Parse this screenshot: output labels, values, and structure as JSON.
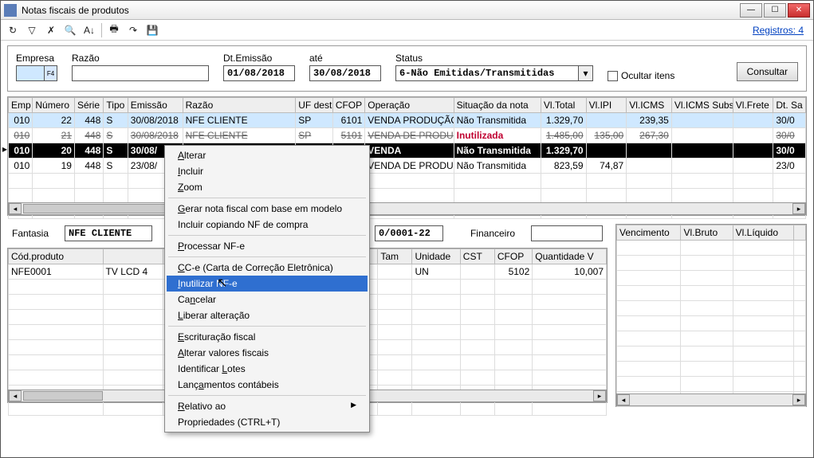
{
  "window": {
    "title": "Notas fiscais de produtos"
  },
  "reg_link": "Registros: 4",
  "filter": {
    "empresa_label": "Empresa",
    "empresa_value": "",
    "razao_label": "Razão",
    "razao_value": "",
    "dtemissao_label": "Dt.Emissão",
    "dtemissao_value": "01/08/2018",
    "ate_label": "até",
    "ate_value": "30/08/2018",
    "status_label": "Status",
    "status_value": "6-Não Emitidas/Transmitidas",
    "ocultar_label": "Ocultar itens",
    "consultar_label": "Consultar"
  },
  "grid1": {
    "columns": [
      "Emp",
      "Número",
      "Série",
      "Tipo",
      "Emissão",
      "Razão",
      "UF dest.",
      "CFOP",
      "Operação",
      "Situação da nota",
      "Vl.Total",
      "Vl.IPI",
      "Vl.ICMS",
      "Vl.ICMS Subs",
      "Vl.Frete",
      "Dt. Sa"
    ],
    "widths": [
      30,
      52,
      36,
      30,
      68,
      140,
      46,
      40,
      110,
      108,
      56,
      50,
      56,
      76,
      50,
      40
    ],
    "rows": [
      {
        "cells": [
          "010",
          "22",
          "448",
          "S",
          "30/08/2018",
          "NFE CLIENTE",
          "SP",
          "6101",
          "VENDA PRODUÇÃO",
          "Não Transmitida",
          "1.329,70",
          "",
          "239,35",
          "",
          "",
          "30/0"
        ],
        "class": "hl"
      },
      {
        "cells": [
          "010",
          "21",
          "448",
          "S",
          "30/08/2018",
          "NFE CLIENTE",
          "SP",
          "5101",
          "VENDA DE PRODU",
          "Inutilizada",
          "1.485,00",
          "135,00",
          "267,30",
          "",
          "",
          "30/0"
        ],
        "class": "canc"
      },
      {
        "cells": [
          "010",
          "20",
          "448",
          "S",
          "30/08/",
          "",
          "",
          "",
          "VENDA",
          "Não Transmitida",
          "1.329,70",
          "",
          "",
          "",
          "",
          "30/0"
        ],
        "class": "sel"
      },
      {
        "cells": [
          "010",
          "19",
          "448",
          "S",
          "23/08/",
          "",
          "",
          "",
          "VENDA DE PRODU",
          "Não Transmitida",
          "823,59",
          "74,87",
          "",
          "",
          "",
          "23/0"
        ],
        "class": ""
      }
    ]
  },
  "details": {
    "fantasia_label": "Fantasia",
    "fantasia_value": "NFE CLIENTE",
    "cnpj_value": "0/0001-22",
    "financeiro_label": "Financeiro",
    "financeiro_value": ""
  },
  "grid2": {
    "columns": [
      "Cód.produto",
      "",
      "",
      "Tam",
      "Unidade",
      "CST",
      "CFOP",
      "Quantidade V"
    ],
    "widths": [
      110,
      70,
      250,
      40,
      56,
      40,
      44,
      86
    ],
    "rows": [
      {
        "cells": [
          "NFE0001",
          "TV LCD 4",
          "",
          "",
          "UN",
          "",
          "5102",
          "10,007"
        ]
      }
    ]
  },
  "grid3": {
    "columns": [
      "Vencimento",
      "Vl.Bruto",
      "Vl.Líquido",
      ""
    ],
    "widths": [
      74,
      60,
      70,
      14
    ]
  },
  "context_menu": {
    "items": [
      {
        "label": "Alterar",
        "u": 0
      },
      {
        "label": "Incluir",
        "u": 0
      },
      {
        "label": "Zoom",
        "u": 0
      },
      {
        "sep": true
      },
      {
        "label": "Gerar nota fiscal com base em modelo",
        "u": 0
      },
      {
        "label": "Incluir copiando NF de compra"
      },
      {
        "sep": true
      },
      {
        "label": "Processar NF-e",
        "u": 0
      },
      {
        "sep": true
      },
      {
        "label": "CC-e (Carta de Correção Eletrônica)",
        "u": 0
      },
      {
        "label": "Inutilizar NF-e",
        "u": 0,
        "hl": true
      },
      {
        "label": "Cancelar",
        "u": 2
      },
      {
        "label": "Liberar alteração",
        "u": 0
      },
      {
        "sep": true
      },
      {
        "label": "Escrituração fiscal",
        "u": 0
      },
      {
        "label": "Alterar valores fiscais",
        "u": 0
      },
      {
        "label": "Identificar Lotes",
        "u": 12
      },
      {
        "label": "Lançamentos contábeis",
        "u": 4
      },
      {
        "sep": true
      },
      {
        "label": "Relativo ao",
        "u": 0,
        "sub": true
      },
      {
        "label": "Propriedades (CTRL+T)"
      }
    ]
  },
  "icons": {
    "refresh": "↻",
    "filter": "▽",
    "filterx": "✗",
    "search": "🔍",
    "sort": "A↓",
    "print": "🖶",
    "arrow": "↷",
    "save": "💾"
  }
}
